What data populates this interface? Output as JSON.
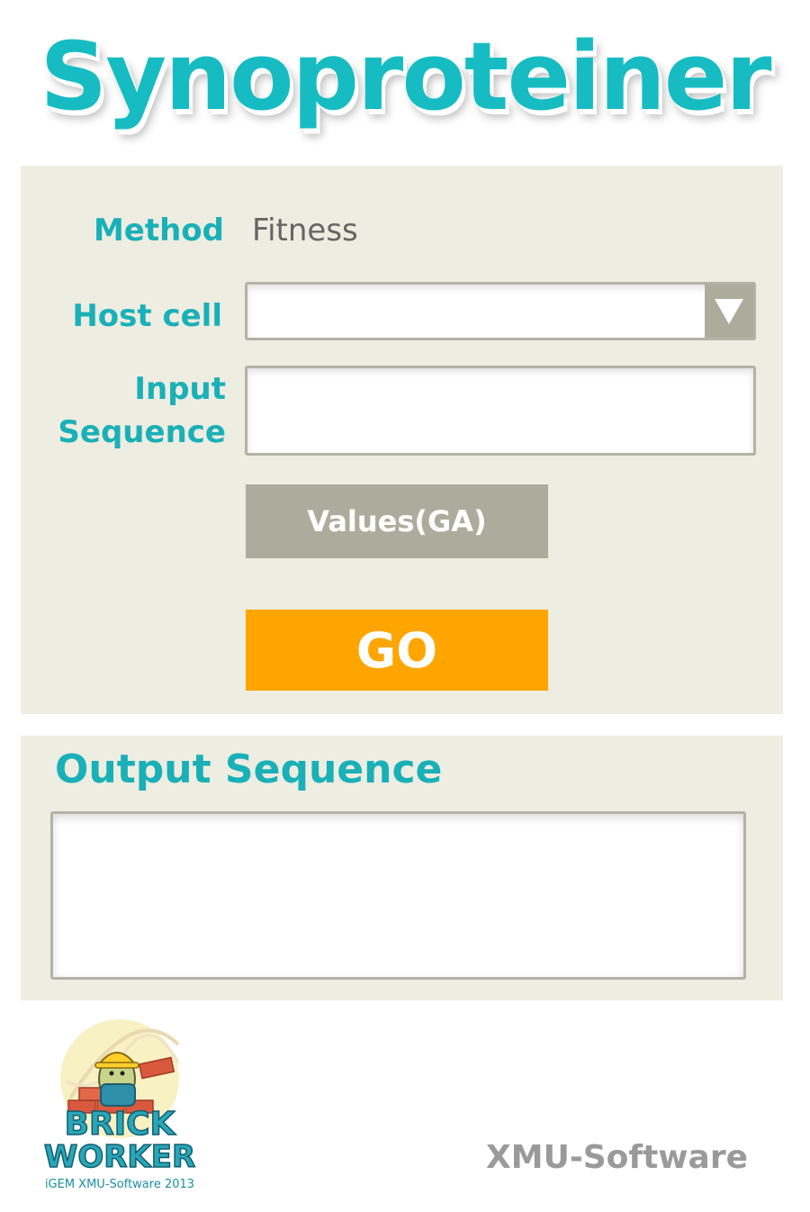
{
  "app": {
    "title": "Synoproteiner"
  },
  "form": {
    "method_label": "Method",
    "method_value": "Fitness",
    "host_cell_label": "Host cell",
    "host_cell_value": "",
    "input_sequence_label_line1": "Input",
    "input_sequence_label_line2": "Sequence",
    "input_sequence_value": "",
    "values_button_label": "Values(GA)",
    "go_button_label": "GO"
  },
  "output": {
    "title": "Output Sequence",
    "value": ""
  },
  "footer": {
    "logo_line1": "BRICK",
    "logo_line2": "WORKER",
    "logo_caption": "iGEM XMU-Software 2013",
    "brand": "XMU-Software"
  },
  "colors": {
    "accent_teal": "#1ab0b8",
    "panel_bg": "#eeede1",
    "button_gray": "#acac9d",
    "go_orange": "#ffa500",
    "muted_text": "#9a9a9a"
  },
  "icons": {
    "dropdown": "chevron-down-icon",
    "logo": "brick-worker-logo"
  }
}
